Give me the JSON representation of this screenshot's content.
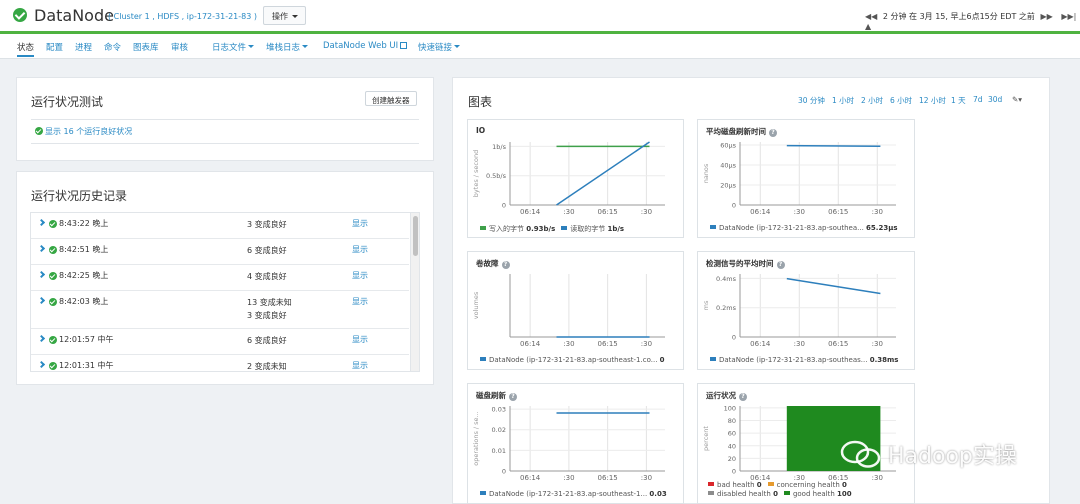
{
  "header": {
    "title": "DataNode",
    "subtitle": "( Cluster 1 , HDFS , ip-172-31-21-83 )",
    "actions_label": "操作",
    "time_text": "2 分钟 在 3月 15, 早上6点15分 EDT 之前"
  },
  "nav": {
    "items": [
      "状态",
      "配置",
      "进程",
      "命令",
      "图表库",
      "审核",
      "日志文件",
      "堆栈日志",
      "DataNode Web UI",
      "快速链接"
    ]
  },
  "health_test": {
    "title": "运行状况测试",
    "create_trigger_label": "创建触发器",
    "summary": "显示 16 个运行良好状况"
  },
  "health_history": {
    "title": "运行状况历史记录",
    "show_label": "显示",
    "rows": [
      {
        "time": "8:43:22 晚上",
        "status": [
          "3 变成良好"
        ]
      },
      {
        "time": "8:42:51 晚上",
        "status": [
          "6 变成良好"
        ]
      },
      {
        "time": "8:42:25 晚上",
        "status": [
          "4 变成良好"
        ]
      },
      {
        "time": "8:42:03 晚上",
        "status": [
          "13 变成未知",
          "3 变成良好"
        ]
      },
      {
        "time": "12:01:57 中午",
        "status": [
          "6 变成良好"
        ]
      },
      {
        "time": "12:01:31 中午",
        "status": [
          "2 变成未知"
        ]
      }
    ]
  },
  "charts_panel": {
    "title": "图表",
    "ranges": [
      "30 分钟",
      "1 小时",
      "2 小时",
      "6 小时",
      "12 小时",
      "1 天",
      "7d",
      "30d"
    ]
  },
  "chart_data": [
    {
      "id": "io",
      "type": "line",
      "title": "IO",
      "ylabel": "bytes / second",
      "x": [
        "06:14",
        ":30",
        "06:15",
        ":30"
      ],
      "yticks": [
        "0",
        "0.5b/s",
        "1b/s"
      ],
      "ylim": [
        0,
        1
      ],
      "series": [
        {
          "name": "写入的字节",
          "summary": "0.93b/s",
          "color": "#3ea04a",
          "points": [
            [
              0.3,
              0.93
            ],
            [
              0.9,
              0.93
            ]
          ]
        },
        {
          "name": "读取的字节",
          "summary": "1b/s",
          "color": "#2d7fbc",
          "points": [
            [
              0.3,
              0.0
            ],
            [
              0.9,
              1.0
            ]
          ]
        }
      ]
    },
    {
      "id": "flush",
      "type": "line",
      "title": "平均磁盘刷新时间",
      "ylabel": "nanos",
      "x": [
        "06:14",
        ":30",
        "06:15",
        ":30"
      ],
      "yticks": [
        "0",
        "20µs",
        "40µs",
        "60µs"
      ],
      "ylim": [
        0,
        70
      ],
      "series": [
        {
          "name": "DataNode (ip-172-31-21-83.ap-southea...",
          "summary": "65.23µs",
          "color": "#2d7fbc",
          "points": [
            [
              0.3,
              66
            ],
            [
              0.9,
              65.23
            ]
          ]
        }
      ]
    },
    {
      "id": "volfail",
      "type": "line",
      "title": "卷故障",
      "ylabel": "volumes",
      "x": [
        "06:14",
        ":30",
        "06:15",
        ":30"
      ],
      "yticks": [],
      "ylim": [
        0,
        1
      ],
      "series": [
        {
          "name": "DataNode (ip-172-31-21-83.ap-southeast-1.co...",
          "summary": "0",
          "color": "#2d7fbc",
          "points": [
            [
              0.3,
              0.0
            ],
            [
              0.9,
              0.0
            ]
          ]
        }
      ]
    },
    {
      "id": "heartbeat",
      "type": "line",
      "title": "检测信号的平均时间",
      "ylabel": "ms",
      "x": [
        "06:14",
        ":30",
        "06:15",
        ":30"
      ],
      "yticks": [
        "0",
        "0.2ms",
        "0.4ms"
      ],
      "ylim": [
        0,
        0.55
      ],
      "series": [
        {
          "name": "DataNode (ip-172-31-21-83.ap-southeas...",
          "summary": "0.38ms",
          "color": "#2d7fbc",
          "points": [
            [
              0.3,
              0.51
            ],
            [
              0.9,
              0.38
            ]
          ]
        }
      ]
    },
    {
      "id": "diskflush",
      "type": "line",
      "title": "磁盘刷新",
      "ylabel": "operations / se...",
      "x": [
        "06:14",
        ":30",
        "06:15",
        ":30"
      ],
      "yticks": [
        "0",
        "0.01",
        "0.02",
        "0.03"
      ],
      "ylim": [
        0,
        0.037
      ],
      "series": [
        {
          "name": "DataNode (ip-172-31-21-83.ap-southeast-1...",
          "summary": "0.03",
          "color": "#2d7fbc",
          "points": [
            [
              0.3,
              0.033
            ],
            [
              0.9,
              0.033
            ]
          ]
        }
      ]
    },
    {
      "id": "health",
      "type": "area",
      "title": "运行状况",
      "ylabel": "percent",
      "x": [
        "06:14",
        ":30",
        "06:15",
        ":30"
      ],
      "yticks": [
        "0",
        "20",
        "40",
        "60",
        "80",
        "100"
      ],
      "ylim": [
        0,
        100
      ],
      "series": [
        {
          "name": "bad health",
          "summary": "0",
          "color": "#d9262b"
        },
        {
          "name": "concerning health",
          "summary": "0",
          "color": "#e69b2f"
        },
        {
          "name": "disabled health",
          "summary": "0",
          "color": "#8c8c8c"
        },
        {
          "name": "good health",
          "summary": "100",
          "color": "#1f8a1f",
          "range": [
            0.3,
            0.9
          ],
          "value": 100
        }
      ]
    }
  ],
  "watermark": "Hadoop实操"
}
